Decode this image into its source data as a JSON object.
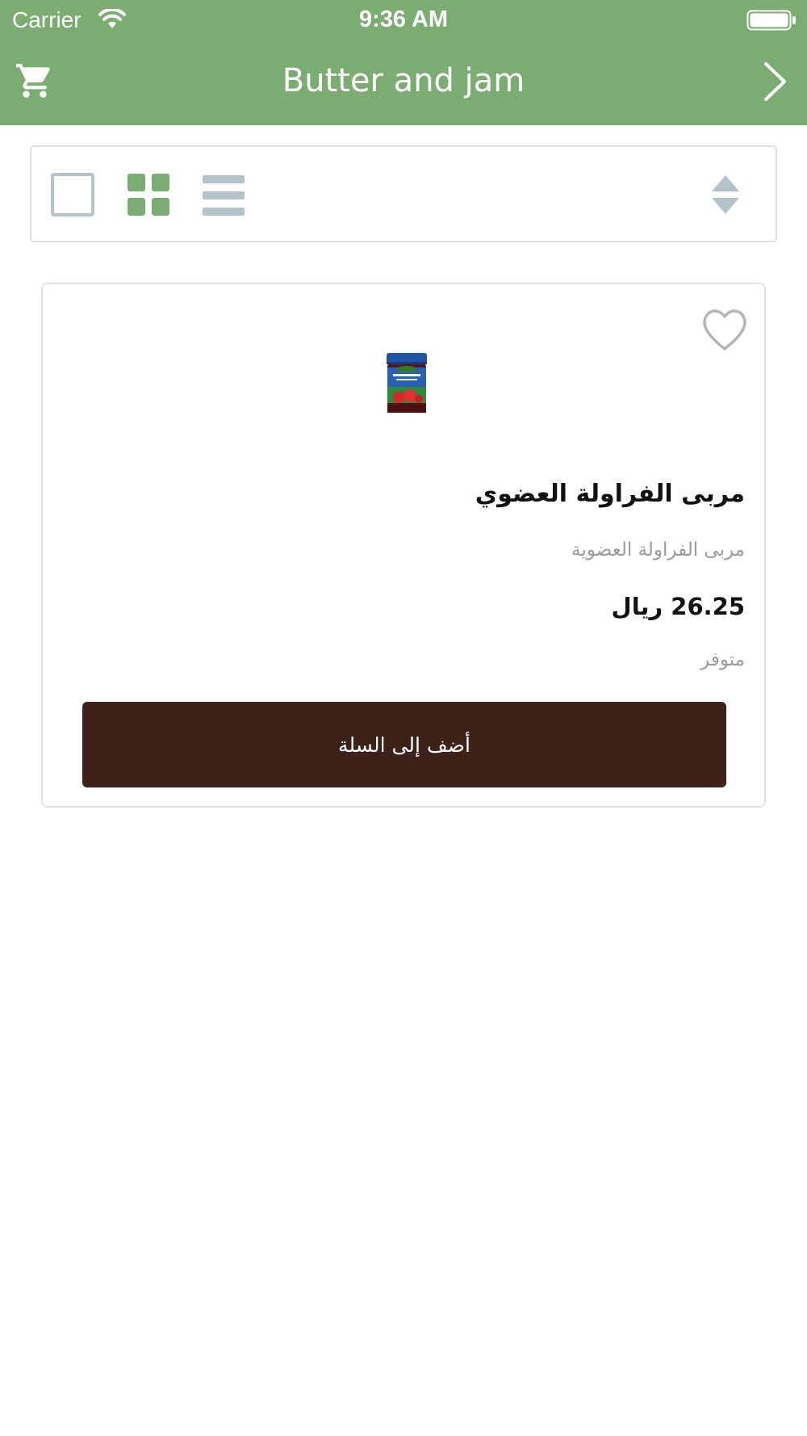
{
  "status_bar": {
    "carrier": "Carrier",
    "time": "9:36 AM",
    "icons": [
      "wifi-icon",
      "battery-icon"
    ]
  },
  "nav": {
    "title": "Butter and jam",
    "left_icon": "cart-icon",
    "right_icon": "chevron-right-icon"
  },
  "toolbar": {
    "view_modes": [
      "single-view-icon",
      "grid-view-icon",
      "list-view-icon"
    ],
    "selected_view": "grid-view-icon",
    "sort_icon": "sort-icon"
  },
  "product": {
    "name": "مربى الفراولة العضوي",
    "subtitle": "مربى الفراولة العضوية",
    "price": "26.25 ريال",
    "availability": "متوفر",
    "add_to_cart_label": "أضف إلى السلة",
    "favorite_icon": "heart-icon"
  },
  "colors": {
    "header": "#7bad73",
    "accent_green": "#7bad73",
    "inactive_icon": "#b3c3cc",
    "button_bg": "#3e2119"
  }
}
